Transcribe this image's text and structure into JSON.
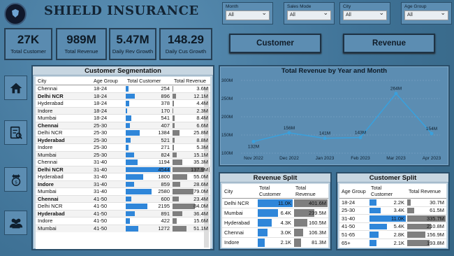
{
  "app": {
    "title": "SHIELD INSURANCE"
  },
  "kpis": [
    {
      "value": "27K",
      "label": "Total Customer"
    },
    {
      "value": "989M",
      "label": "Total Revenue"
    },
    {
      "value": "5.47M",
      "label": "Daily Rev Growth"
    },
    {
      "value": "148.29",
      "label": "Daily Cus Growth"
    }
  ],
  "slicers": [
    {
      "label": "Month",
      "value": "All"
    },
    {
      "label": "Sales Mode",
      "value": "All"
    },
    {
      "label": "City",
      "value": "All"
    },
    {
      "label": "Age Group",
      "value": "All"
    }
  ],
  "buttons": {
    "customer": "Customer",
    "revenue": "Revenue"
  },
  "nav": [
    {
      "icon": "home-icon"
    },
    {
      "icon": "report-icon"
    },
    {
      "icon": "money-growth-icon"
    },
    {
      "icon": "users-icon"
    }
  ],
  "segmentation": {
    "title": "Customer Segmentation",
    "headers": [
      "City",
      "Age Group",
      "Total Customer",
      "Total Revenue"
    ],
    "max_customer": 4544,
    "max_revenue": 137.9,
    "rows": [
      {
        "city": "Chennai",
        "age": "18-24",
        "cust": "254",
        "cust_n": 254,
        "rev": "3.6M",
        "rev_n": 3.6,
        "bold": false
      },
      {
        "city": "Delhi NCR",
        "age": "18-24",
        "cust": "896",
        "cust_n": 896,
        "rev": "12.1M",
        "rev_n": 12.1,
        "bold": true
      },
      {
        "city": "Hyderabad",
        "age": "18-24",
        "cust": "378",
        "cust_n": 378,
        "rev": "4.4M",
        "rev_n": 4.4,
        "bold": false
      },
      {
        "city": "Indore",
        "age": "18-24",
        "cust": "170",
        "cust_n": 170,
        "rev": "2.3M",
        "rev_n": 2.3,
        "bold": false
      },
      {
        "city": "Mumbai",
        "age": "18-24",
        "cust": "541",
        "cust_n": 541,
        "rev": "8.4M",
        "rev_n": 8.4,
        "bold": false
      },
      {
        "city": "Chennai",
        "age": "25-30",
        "cust": "407",
        "cust_n": 407,
        "rev": "6.6M",
        "rev_n": 6.6,
        "bold": true
      },
      {
        "city": "Delhi NCR",
        "age": "25-30",
        "cust": "1384",
        "cust_n": 1384,
        "rev": "25.8M",
        "rev_n": 25.8,
        "bold": false
      },
      {
        "city": "Hyderabad",
        "age": "25-30",
        "cust": "521",
        "cust_n": 521,
        "rev": "8.8M",
        "rev_n": 8.8,
        "bold": true
      },
      {
        "city": "Indore",
        "age": "25-30",
        "cust": "271",
        "cust_n": 271,
        "rev": "5.3M",
        "rev_n": 5.3,
        "bold": false
      },
      {
        "city": "Mumbai",
        "age": "25-30",
        "cust": "824",
        "cust_n": 824,
        "rev": "15.1M",
        "rev_n": 15.1,
        "bold": false
      },
      {
        "city": "Chennai",
        "age": "31-40",
        "cust": "1194",
        "cust_n": 1194,
        "rev": "35.3M",
        "rev_n": 35.3,
        "bold": false
      },
      {
        "city": "Delhi NCR",
        "age": "31-40",
        "cust": "4544",
        "cust_n": 4544,
        "rev": "137.9M",
        "rev_n": 137.9,
        "bold": true
      },
      {
        "city": "Hyderabad",
        "age": "31-40",
        "cust": "1800",
        "cust_n": 1800,
        "rev": "55.0M",
        "rev_n": 55.0,
        "bold": false
      },
      {
        "city": "Indore",
        "age": "31-40",
        "cust": "859",
        "cust_n": 859,
        "rev": "28.6M",
        "rev_n": 28.6,
        "bold": true
      },
      {
        "city": "Mumbai",
        "age": "31-40",
        "cust": "2580",
        "cust_n": 2580,
        "rev": "79.0M",
        "rev_n": 79.0,
        "bold": false
      },
      {
        "city": "Chennai",
        "age": "41-50",
        "cust": "600",
        "cust_n": 600,
        "rev": "23.4M",
        "rev_n": 23.4,
        "bold": true
      },
      {
        "city": "Delhi NCR",
        "age": "41-50",
        "cust": "2195",
        "cust_n": 2195,
        "rev": "84.0M",
        "rev_n": 84.0,
        "bold": false
      },
      {
        "city": "Hyderabad",
        "age": "41-50",
        "cust": "891",
        "cust_n": 891,
        "rev": "36.4M",
        "rev_n": 36.4,
        "bold": true
      },
      {
        "city": "Indore",
        "age": "41-50",
        "cust": "422",
        "cust_n": 422,
        "rev": "15.6M",
        "rev_n": 15.6,
        "bold": false
      },
      {
        "city": "Mumbai",
        "age": "41-50",
        "cust": "1272",
        "cust_n": 1272,
        "rev": "51.1M",
        "rev_n": 51.1,
        "bold": false
      }
    ]
  },
  "chart_data": {
    "type": "line",
    "title": "Total Revenue by Year and Month",
    "categories": [
      "Nov 2022",
      "Dec 2022",
      "Jan 2023",
      "Feb 2023",
      "Mar 2023",
      "Apr 2023"
    ],
    "values": [
      132,
      156,
      141,
      143,
      264,
      154
    ],
    "value_labels": [
      "132M",
      "156M",
      "141M",
      "143M",
      "264M",
      "154M"
    ],
    "yticks": [
      "100M",
      "150M",
      "200M",
      "250M",
      "300M"
    ],
    "ylim": [
      100,
      300
    ],
    "grid": true,
    "line_color": "#3aa0dc"
  },
  "revenue_split": {
    "title": "Revenue Split",
    "headers": [
      "City",
      "Total Customer",
      "Total Revenue"
    ],
    "max_customer": 11.0,
    "max_revenue": 401.6,
    "rows": [
      {
        "city": "Delhi NCR",
        "cust": "11.0K",
        "cust_n": 11.0,
        "rev": "401.6M",
        "rev_n": 401.6
      },
      {
        "city": "Mumbai",
        "cust": "6.4K",
        "cust_n": 6.4,
        "rev": "239.5M",
        "rev_n": 239.5
      },
      {
        "city": "Hyderabad",
        "cust": "4.3K",
        "cust_n": 4.3,
        "rev": "160.5M",
        "rev_n": 160.5
      },
      {
        "city": "Chennai",
        "cust": "3.0K",
        "cust_n": 3.0,
        "rev": "106.3M",
        "rev_n": 106.3
      },
      {
        "city": "Indore",
        "cust": "2.1K",
        "cust_n": 2.1,
        "rev": "81.3M",
        "rev_n": 81.3
      }
    ]
  },
  "customer_split": {
    "title": "Customer Split",
    "headers": [
      "Age Group",
      "Total Customer",
      "Total Revenue"
    ],
    "max_customer": 11.0,
    "max_revenue": 335.7,
    "rows": [
      {
        "age": "18-24",
        "cust": "2.2K",
        "cust_n": 2.2,
        "rev": "30.7M",
        "rev_n": 30.7
      },
      {
        "age": "25-30",
        "cust": "3.4K",
        "cust_n": 3.4,
        "rev": "61.5M",
        "rev_n": 61.5
      },
      {
        "age": "31-40",
        "cust": "11.0K",
        "cust_n": 11.0,
        "rev": "335.7M",
        "rev_n": 335.7
      },
      {
        "age": "41-50",
        "cust": "5.4K",
        "cust_n": 5.4,
        "rev": "210.8M",
        "rev_n": 210.8
      },
      {
        "age": "51-65",
        "cust": "2.8K",
        "cust_n": 2.8,
        "rev": "156.9M",
        "rev_n": 156.9
      },
      {
        "age": "65+",
        "cust": "2.1K",
        "cust_n": 2.1,
        "rev": "193.8M",
        "rev_n": 193.8
      }
    ]
  }
}
